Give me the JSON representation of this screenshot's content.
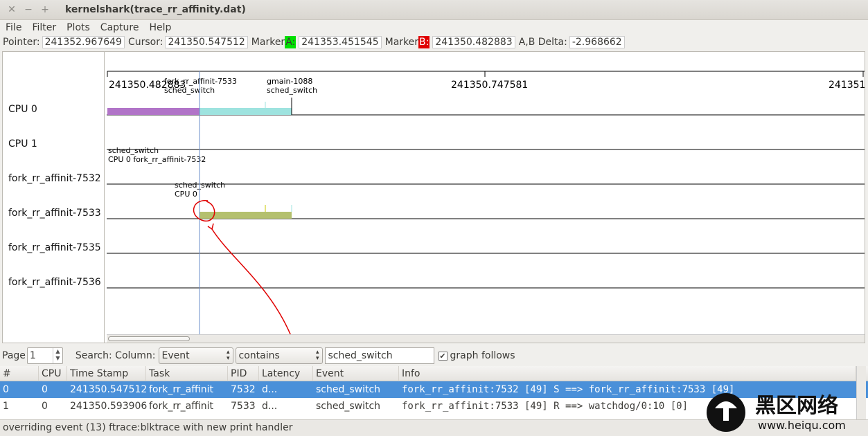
{
  "window": {
    "title": "kernelshark(trace_rr_affinity.dat)"
  },
  "menu": [
    "File",
    "Filter",
    "Plots",
    "Capture",
    "Help"
  ],
  "info": {
    "pointer_label": "Pointer:",
    "pointer": "241352.967649",
    "cursor_label": "Cursor:",
    "cursor": "241350.547512",
    "marker_label": "Marker",
    "marker_a": "A:",
    "marker_a_val": "241353.451545",
    "marker_b": "B:",
    "marker_b_val": "241350.482883",
    "delta_label": "A,B Delta:",
    "delta": "-2.968662"
  },
  "graph": {
    "rows": [
      "CPU 0",
      "CPU 1",
      "fork_rr_affinit-7532",
      "fork_rr_affinit-7533",
      "fork_rr_affinit-7535",
      "fork_rr_affinit-7536"
    ],
    "timestamps": [
      "241350.482883",
      "241350.747581",
      "241351."
    ],
    "annotations": {
      "a1_line1": "fork_rr_affinit-7533",
      "a1_line2": "sched_switch",
      "a2_line1": "gmain-1088",
      "a2_line2": "sched_switch",
      "a3_line1": "sched_switch",
      "a3_line2": "CPU 0 fork_rr_affinit-7532",
      "a4_line1": "sched_switch",
      "a4_line2": "CPU 0"
    },
    "colors": {
      "cpu0_a": "#b174c8",
      "cpu0_b": "#9ee3df",
      "task7533": "#b4c06e",
      "cursor": "#6a8ec8"
    }
  },
  "search": {
    "page_label": "Page",
    "page": "1",
    "search_label": "Search: Column:",
    "column": "Event",
    "op": "contains",
    "text": "sched_switch",
    "graph_follows": "graph follows"
  },
  "table": {
    "headers": [
      "#",
      "CPU",
      "Time Stamp",
      "Task",
      "PID",
      "Latency",
      "Event",
      "Info"
    ],
    "rows": [
      [
        "0",
        "0",
        "241350.547512",
        "fork_rr_affinit",
        "7532",
        "d...",
        "sched_switch",
        "fork_rr_affinit:7532 [49] S ==> fork_rr_affinit:7533 [49]"
      ],
      [
        "1",
        "0",
        "241350.593906",
        "fork_rr_affinit",
        "7533",
        "d...",
        "sched_switch",
        "fork_rr_affinit:7533 [49] R ==> watchdog/0:10 [0]"
      ]
    ]
  },
  "status": "overriding event (13) ftrace:blktrace with new print handler",
  "watermark": {
    "cn": "黑区网络",
    "url": "www.heiqu.com"
  }
}
